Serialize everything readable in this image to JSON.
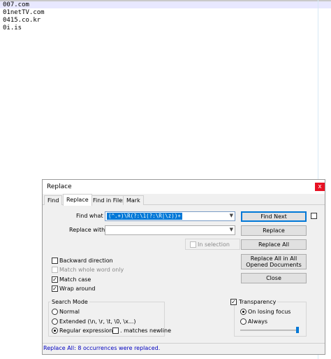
{
  "editor": {
    "lines": [
      "007.com",
      "01netTV.com",
      "0415.co.kr",
      "0i.is"
    ]
  },
  "dialog": {
    "title": "Replace",
    "close_glyph": "x",
    "tabs": [
      "Find",
      "Replace",
      "Find in Files",
      "Mark"
    ],
    "active_tab": "Replace",
    "find_what_label": "Find what :",
    "find_what_value": "(^.+)\\R(?:\\1(?:\\R|\\z))+",
    "replace_with_label": "Replace with :",
    "replace_with_value": "",
    "in_selection_label": "In selection",
    "buttons": {
      "find_next": "Find Next",
      "replace": "Replace",
      "replace_all": "Replace All",
      "replace_all_opened": "Replace All in All Opened Documents",
      "close": "Close"
    },
    "options": {
      "backward_direction": "Backward direction",
      "match_whole_word": "Match whole word only",
      "match_case": "Match case",
      "wrap_around": "Wrap around"
    },
    "search_mode": {
      "title": "Search Mode",
      "normal": "Normal",
      "extended": "Extended (\\n, \\r, \\t, \\0, \\x...)",
      "regex": "Regular expression",
      "matches_newline": ". matches newline"
    },
    "transparency": {
      "title": "Transparency",
      "on_losing_focus": "On losing focus",
      "always": "Always"
    },
    "status": "Replace All: 8 occurrences were replaced."
  },
  "colors": {
    "accent": "#0078d7",
    "status_text": "#0000c0",
    "close_button": "#e81123"
  }
}
